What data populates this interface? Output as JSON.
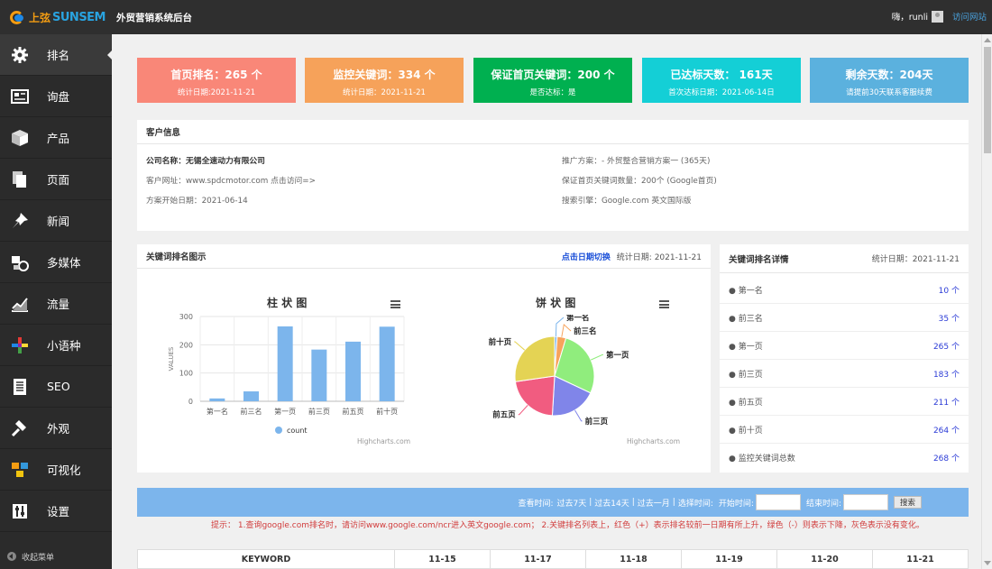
{
  "app": {
    "brand_cn": "上弦",
    "brand_en": "SUNSEM",
    "title": "外贸营销系统后台"
  },
  "user": {
    "greeting": "嗨，runli",
    "visit_label": "访问网站"
  },
  "sidebar": {
    "items": [
      {
        "label": "排名",
        "icon": "gear-icon"
      },
      {
        "label": "询盘",
        "icon": "inbox-icon"
      },
      {
        "label": "产品",
        "icon": "box-icon"
      },
      {
        "label": "页面",
        "icon": "pages-icon"
      },
      {
        "label": "新闻",
        "icon": "pin-icon"
      },
      {
        "label": "多媒体",
        "icon": "media-icon"
      },
      {
        "label": "流量",
        "icon": "traffic-icon"
      },
      {
        "label": "小语种",
        "icon": "language-icon"
      },
      {
        "label": "SEO",
        "icon": "document-icon"
      },
      {
        "label": "外观",
        "icon": "hammer-icon"
      },
      {
        "label": "可视化",
        "icon": "cubes-icon"
      },
      {
        "label": "设置",
        "icon": "settings-icon"
      }
    ],
    "collapse_label": "收起菜单"
  },
  "stats": [
    {
      "title": "首页排名：265 个",
      "sub": "统计日期:2021-11-21",
      "color": "#f98778"
    },
    {
      "title": "监控关键词：334 个",
      "sub": "统计日期：2021-11-21",
      "color": "#f6a25a"
    },
    {
      "title": "保证首页关键词：200 个",
      "sub": "是否达标：是",
      "color": "#00b050"
    },
    {
      "title": "已达标天数： 161天",
      "sub": "首次达标日期：2021-06-14日",
      "color": "#14cfd6"
    },
    {
      "title": "剩余天数：204天",
      "sub": "请提前30天联系客服续费",
      "color": "#5bb1de"
    }
  ],
  "customer": {
    "heading": "客户信息",
    "company_label": "公司名称：",
    "company": "无锡全速动力有限公司",
    "plan": "推广方案：- 外贸整合营销方案一 (365天)",
    "site": "客户网址：www.spdcmotor.com 点击访问=>",
    "keywords": "保证首页关键词数量：200个 (Google首页)",
    "start": "方案开始日期：2021-06-14",
    "engine": "搜索引擎：Google.com 英文国际版"
  },
  "chart_card": {
    "heading": "关键词排名图示",
    "switch_label": "点击日期切换",
    "date_label": "统计日期: 2021-11-21",
    "credit": "Highcharts.com"
  },
  "chart_data": [
    {
      "type": "bar",
      "title": "柱 状 图",
      "categories": [
        "第一名",
        "前三名",
        "第一页",
        "前三页",
        "前五页",
        "前十页"
      ],
      "series": [
        {
          "name": "count",
          "values": [
            10,
            35,
            265,
            183,
            211,
            264
          ]
        }
      ],
      "ylabel": "VALUES",
      "ylim": [
        0,
        300
      ],
      "yticks": [
        "0",
        "100",
        "200",
        "300"
      ],
      "grid": true,
      "legend": "bottom-center",
      "color": "#7cb5ec"
    },
    {
      "type": "pie",
      "title": "饼 状 图",
      "labels": [
        "第一名",
        "前三名",
        "第一页",
        "前三页",
        "前五页",
        "前十页"
      ],
      "values": [
        10,
        35,
        265,
        183,
        211,
        264
      ],
      "colors": [
        "#7cb5ec",
        "#f7a35c",
        "#90ed7d",
        "#8085e9",
        "#f15c80",
        "#e4d354"
      ]
    }
  ],
  "detail": {
    "heading": "关键词排名详情",
    "date_label": "统计日期：2021-11-21",
    "rows": [
      {
        "label": "● 第一名",
        "value": "10 个"
      },
      {
        "label": "● 前三名",
        "value": "35 个"
      },
      {
        "label": "● 第一页",
        "value": "265 个"
      },
      {
        "label": "● 前三页",
        "value": "183 个"
      },
      {
        "label": "● 前五页",
        "value": "211 个"
      },
      {
        "label": "● 前十页",
        "value": "264 个"
      },
      {
        "label": "● 监控关键词总数",
        "value": "268 个"
      }
    ]
  },
  "filter": {
    "query_label": "查看时间:",
    "options": [
      "过去7天",
      "过去14天",
      "过去一月"
    ],
    "select_label": "选择时间:",
    "start_label": "开始时间:",
    "end_label": "结束时间:",
    "search_label": "搜索"
  },
  "tip": "提示： 1.查询google.com排名时，请访问www.google.com/ncr进入英文google.com； 2.关键排名列表上，红色（+）表示排名较前一日期有所上升，绿色（-）则表示下降，灰色表示没有变化。",
  "table": {
    "columns": [
      "KEYWORD",
      "11-15",
      "11-17",
      "11-18",
      "11-19",
      "11-20",
      "11-21"
    ]
  }
}
